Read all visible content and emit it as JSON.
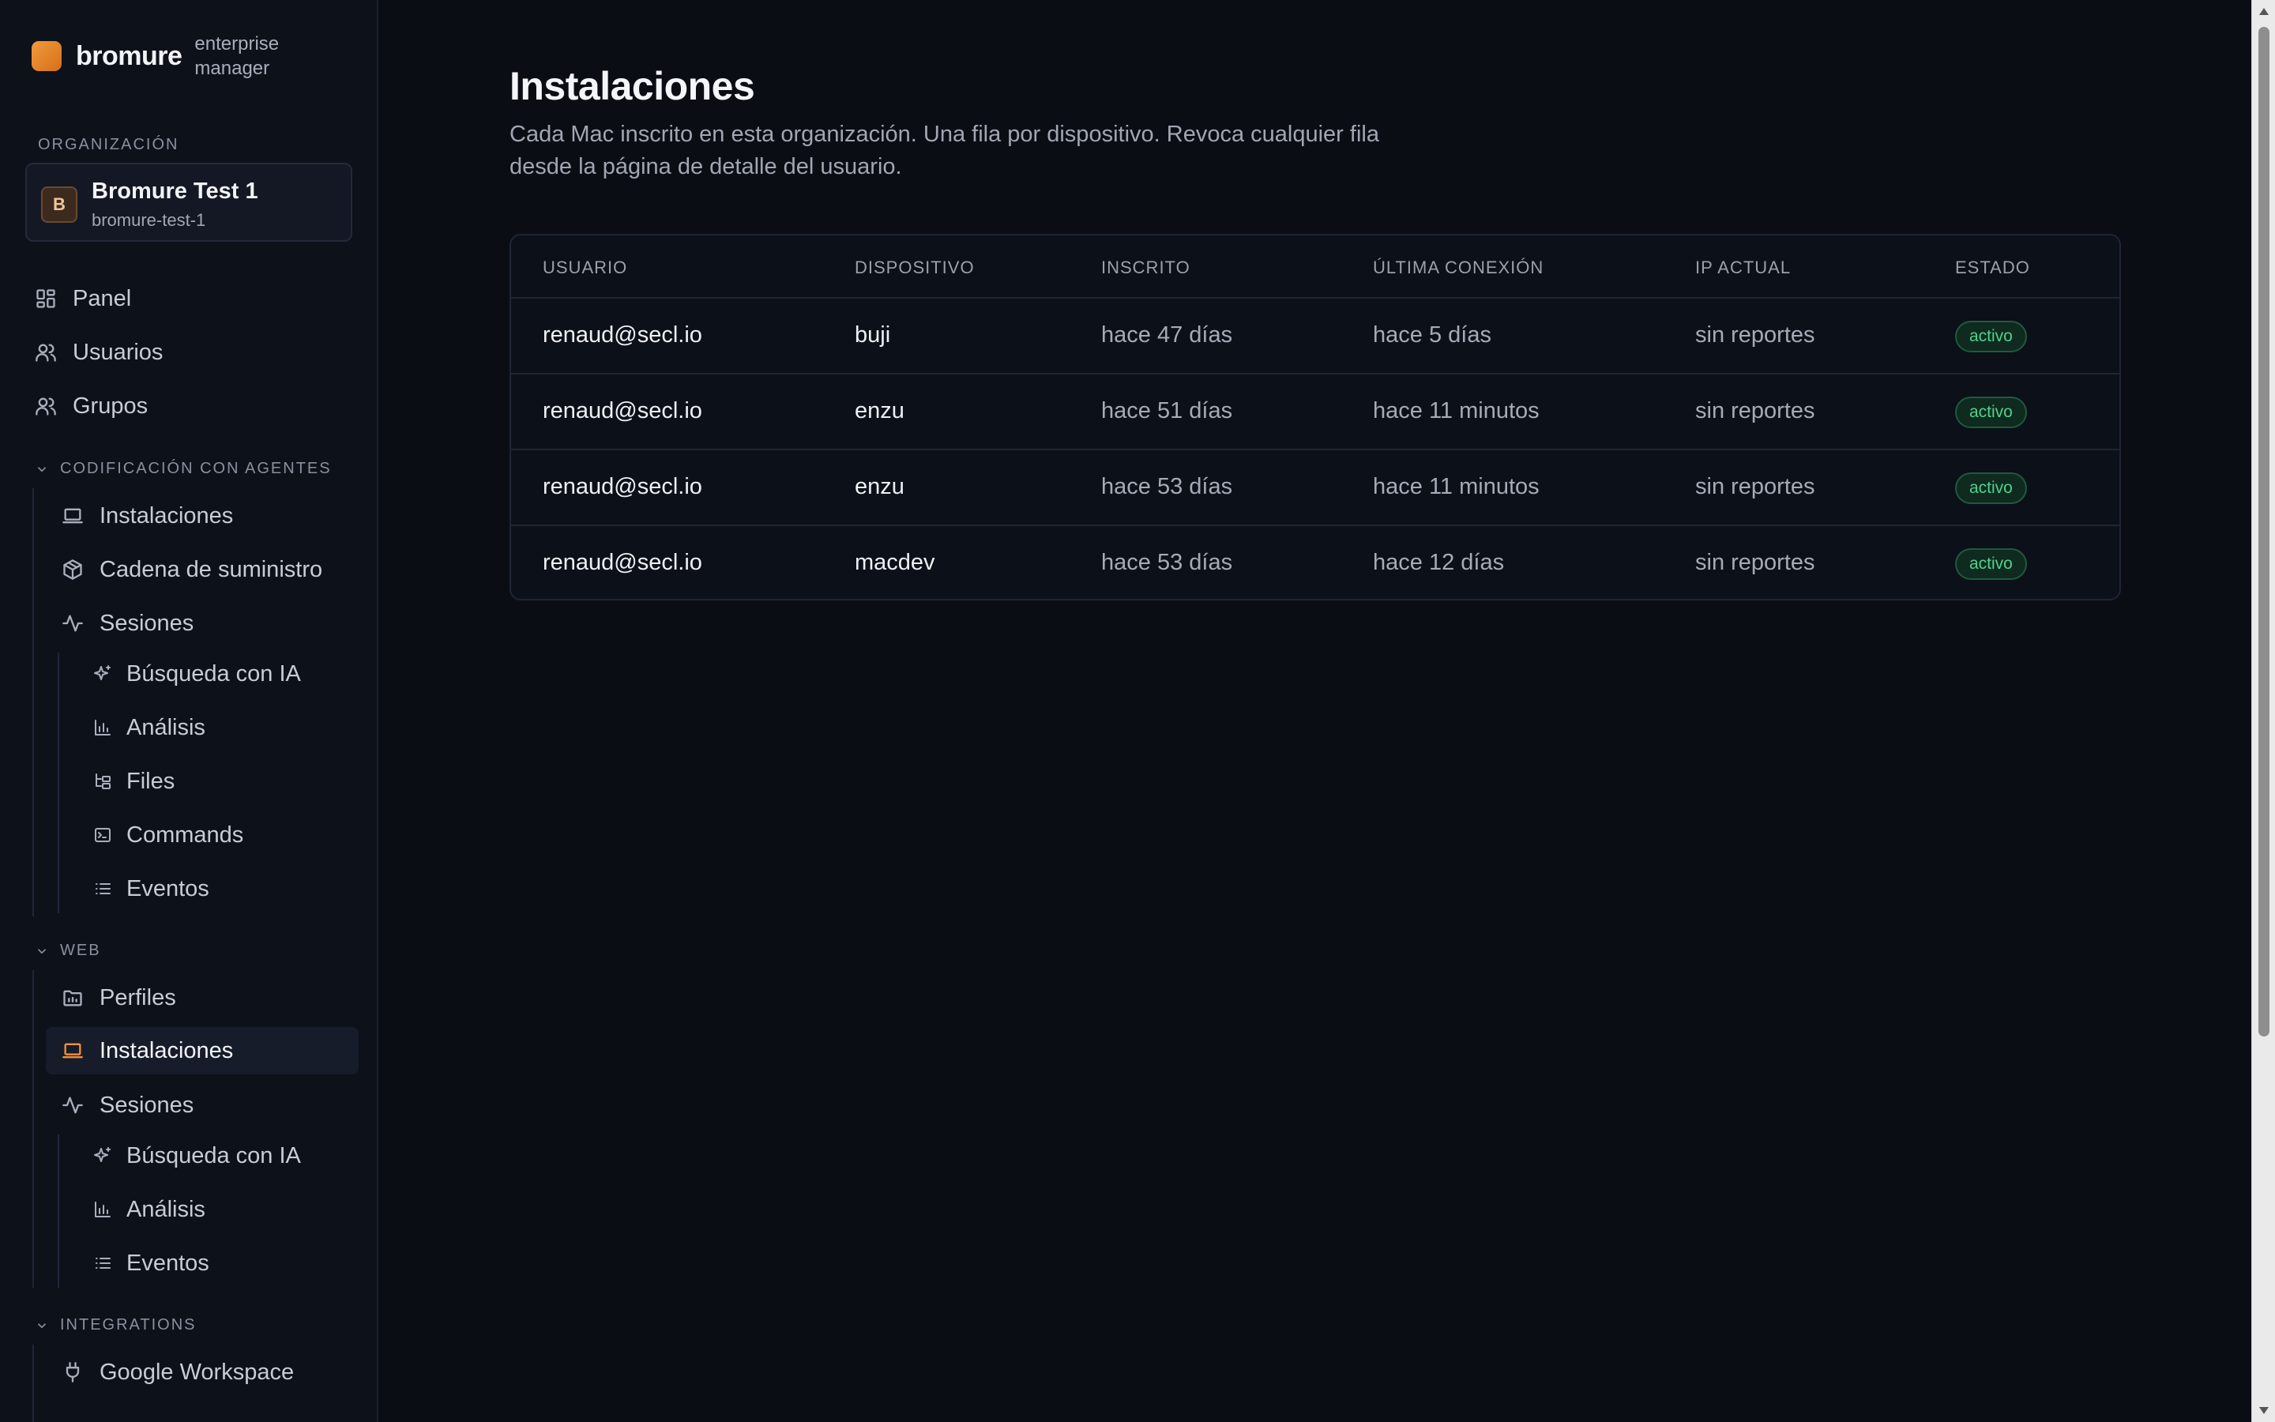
{
  "brand": {
    "name": "bromure",
    "subtitle": "enterprise manager"
  },
  "sidebar": {
    "org_label": "ORGANIZACIÓN",
    "org": {
      "initial": "B",
      "name": "Bromure Test 1",
      "slug": "bromure-test-1"
    },
    "main_items": [
      {
        "label": "Panel",
        "icon": "dashboard-icon"
      },
      {
        "label": "Usuarios",
        "icon": "users-icon"
      },
      {
        "label": "Grupos",
        "icon": "groups-icon"
      }
    ],
    "groups": [
      {
        "title": "CODIFICACIÓN CON AGENTES",
        "items": [
          {
            "label": "Instalaciones",
            "icon": "laptop-icon"
          },
          {
            "label": "Cadena de suministro",
            "icon": "package-icon"
          },
          {
            "label": "Sesiones",
            "icon": "activity-icon"
          }
        ],
        "sub_items": [
          {
            "label": "Búsqueda con IA",
            "icon": "sparkles-icon"
          },
          {
            "label": "Análisis",
            "icon": "bar-chart-icon"
          },
          {
            "label": "Files",
            "icon": "folder-tree-icon"
          },
          {
            "label": "Commands",
            "icon": "terminal-icon"
          },
          {
            "label": "Eventos",
            "icon": "list-icon"
          }
        ]
      },
      {
        "title": "WEB",
        "items": [
          {
            "label": "Perfiles",
            "icon": "folder-profile-icon"
          },
          {
            "label": "Instalaciones",
            "icon": "laptop-icon",
            "active": true
          },
          {
            "label": "Sesiones",
            "icon": "activity-icon"
          }
        ],
        "sub_items": [
          {
            "label": "Búsqueda con IA",
            "icon": "sparkles-icon"
          },
          {
            "label": "Análisis",
            "icon": "bar-chart-icon"
          },
          {
            "label": "Eventos",
            "icon": "list-icon"
          }
        ]
      },
      {
        "title": "INTEGRATIONS",
        "items": [
          {
            "label": "Google Workspace",
            "icon": "plug-icon"
          }
        ]
      }
    ]
  },
  "main": {
    "title": "Instalaciones",
    "description": "Cada Mac inscrito en esta organización. Una fila por dispositivo. Revoca cualquier fila desde la página de detalle del usuario.",
    "table": {
      "headers": [
        "USUARIO",
        "DISPOSITIVO",
        "INSCRITO",
        "ÚLTIMA CONEXIÓN",
        "IP ACTUAL",
        "ESTADO"
      ],
      "rows": [
        [
          "renaud@secl.io",
          "buji",
          "hace 47 días",
          "hace 5 días",
          "sin reportes",
          "activo"
        ],
        [
          "renaud@secl.io",
          "enzu",
          "hace 51 días",
          "hace 11 minutos",
          "sin reportes",
          "activo"
        ],
        [
          "renaud@secl.io",
          "enzu",
          "hace 53 días",
          "hace 11 minutos",
          "sin reportes",
          "activo"
        ],
        [
          "renaud@secl.io",
          "macdev",
          "hace 53 días",
          "hace 12 días",
          "sin reportes",
          "activo"
        ]
      ]
    }
  },
  "colors": {
    "accent": "#f0913a",
    "status_active": "#4fd18b",
    "background": "#0a0d14"
  }
}
